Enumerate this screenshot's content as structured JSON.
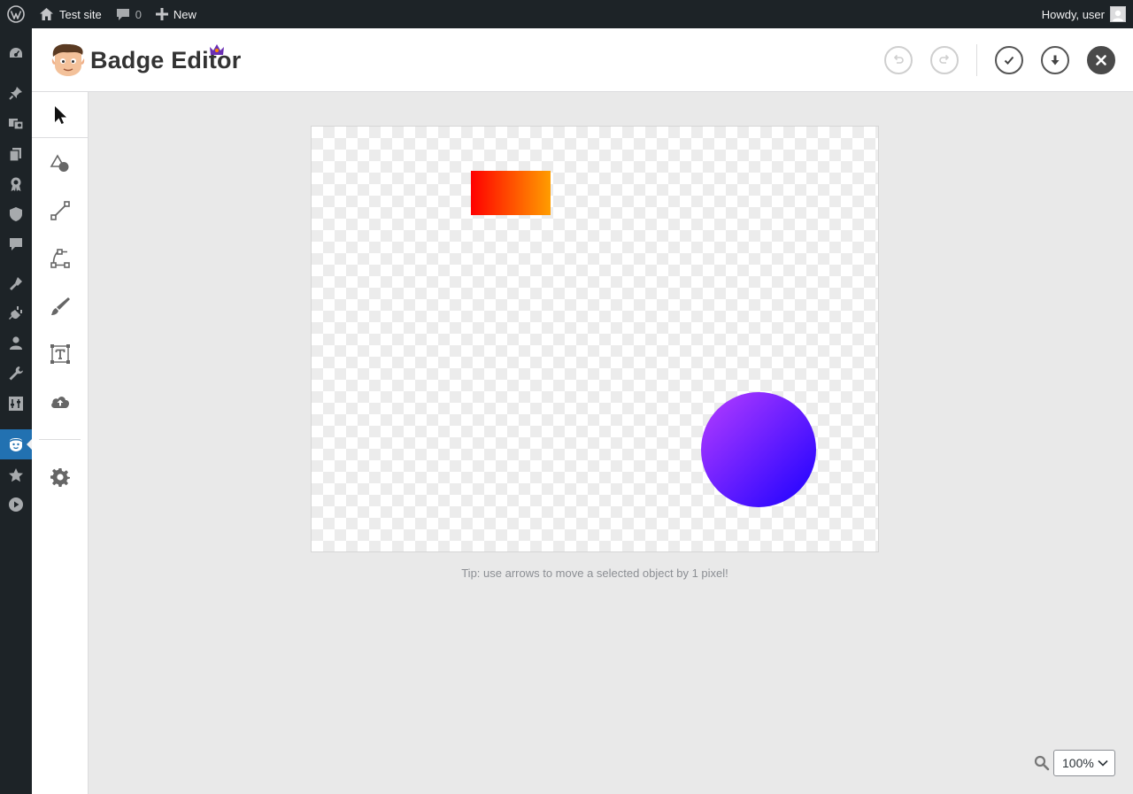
{
  "adminbar": {
    "site_name": "Test site",
    "comments_count": "0",
    "new_label": "New",
    "greeting": "Howdy, user"
  },
  "adminmenu": {
    "icons": [
      "dashboard-icon",
      "pin-icon",
      "media-icon",
      "pages-icon",
      "badge-icon",
      "shield-icon",
      "comments-icon",
      "appearance-icon",
      "plugins-icon",
      "users-icon",
      "tools-icon",
      "settings-icon",
      "badge-editor-icon",
      "star-icon",
      "play-icon"
    ],
    "active": "badge-editor-icon"
  },
  "header": {
    "logo_text": "Badge Editor"
  },
  "toolbar": {
    "tools": [
      "select-tool",
      "shape-tool",
      "line-tool",
      "path-tool",
      "brush-tool",
      "text-tool",
      "upload-tool",
      "settings-tool"
    ],
    "active": "select-tool"
  },
  "canvas": {
    "shapes": [
      {
        "type": "rectangle",
        "fill_start": "#ff0000",
        "fill_end": "#ff9d00"
      },
      {
        "type": "circle",
        "fill_start": "#b73dff",
        "fill_end": "#1a00ff"
      }
    ]
  },
  "tip": "Tip: use arrows to move a selected object by 1 pixel!",
  "zoom": {
    "value": "100%"
  },
  "colors": {
    "adminbar_bg": "#1d2327",
    "active_menu": "#2271b1",
    "editor_bg": "#e9e9e9"
  }
}
